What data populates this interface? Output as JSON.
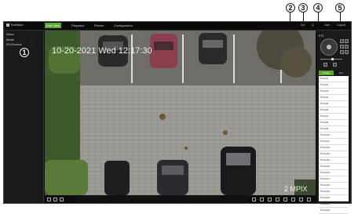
{
  "topbar": {
    "brand": "TruVision",
    "tabs": [
      "Live View",
      "Playback",
      "Picture",
      "Configuration"
    ],
    "right_items": [
      "Scr",
      "Q",
      "User",
      "Logout"
    ]
  },
  "left_panel": {
    "lines": [
      "Status",
      "Bitrate",
      "IPS/Channel"
    ],
    "values": [
      "--",
      "--",
      "--"
    ]
  },
  "video": {
    "timestamp": "10-20-2021 Wed 12:17:30",
    "resolution": "2 MPIX"
  },
  "right_panel": {
    "ptz_title": "PTZ",
    "preset_tabs": [
      "Preset",
      "Tour"
    ],
    "presets": [
      "Preset1",
      "Preset2",
      "Preset3",
      "Preset4",
      "Preset5",
      "Preset6",
      "Preset7",
      "Preset8",
      "Preset9",
      "Preset10",
      "Preset11",
      "Preset12",
      "Preset13",
      "Preset14",
      "Preset15",
      "Preset16",
      "Preset17",
      "Preset18",
      "Preset19",
      "Preset20",
      "Preset21",
      "Preset22",
      "Preset23"
    ]
  },
  "callouts": [
    "1",
    "2",
    "3",
    "4",
    "5"
  ],
  "icons": [
    "record-icon",
    "snapshot-icon",
    "zoom-icon",
    "audio-icon",
    "fullscreen-icon"
  ]
}
